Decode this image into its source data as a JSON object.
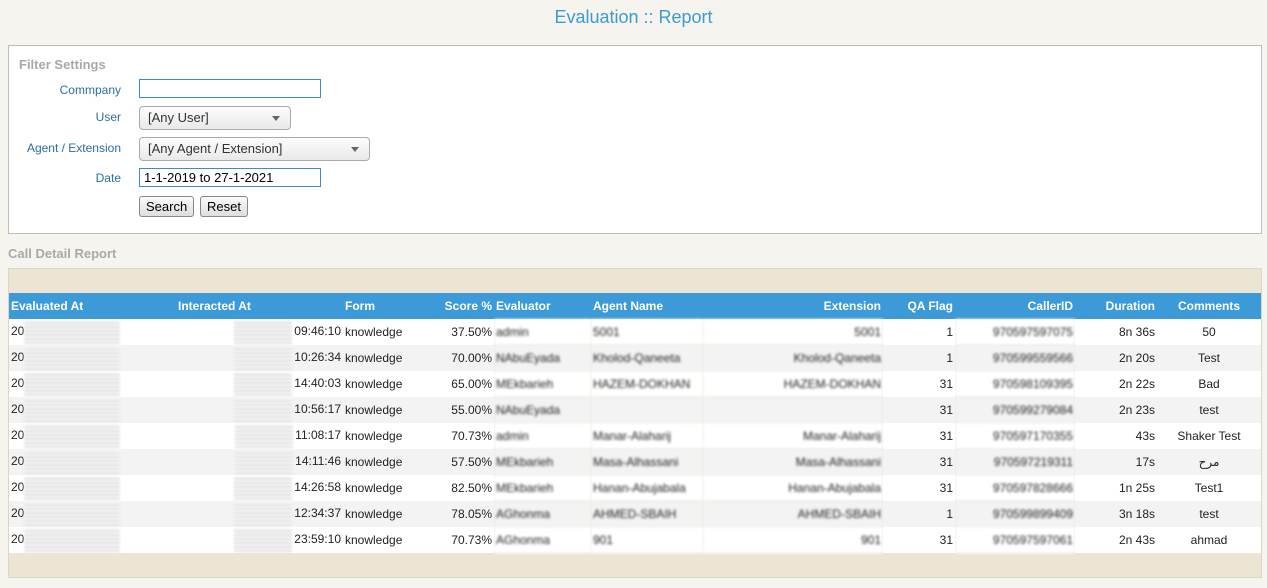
{
  "page": {
    "title": "Evaluation :: Report"
  },
  "filter": {
    "legend": "Filter Settings",
    "company_label": "Commpany",
    "company_value": "",
    "user_label": "User",
    "user_selected": "[Any User]",
    "agent_label": "Agent / Extension",
    "agent_selected": "[Any Agent / Extension]",
    "date_label": "Date",
    "date_value": "1-1-2019 to 27-1-2021",
    "search_button": "Search",
    "reset_button": "Reset"
  },
  "report": {
    "title": "Call Detail Report",
    "columns": [
      "Evaluated At",
      "Interacted At",
      "Form",
      "Score %",
      "Evaluator",
      "Agent Name",
      "Extension",
      "QA Flag",
      "CallerID",
      "Duration",
      "Comments"
    ],
    "rows": [
      {
        "evaluated_prefix": "20",
        "interacted_time": "09:46:10",
        "form": "knowledge",
        "score": "37.50%",
        "evaluator": "admin",
        "agent_name": "5001",
        "extension": "5001",
        "qa_flag": "1",
        "caller_id": "970597597075",
        "duration": "8n 36s",
        "comments": "50"
      },
      {
        "evaluated_prefix": "20",
        "interacted_time": "10:26:34",
        "form": "knowledge",
        "score": "70.00%",
        "evaluator": "NAbuEyada",
        "agent_name": "Kholod-Qaneeta",
        "extension": "Kholod-Qaneeta",
        "qa_flag": "1",
        "caller_id": "970599559566",
        "duration": "2n 20s",
        "comments": "Test"
      },
      {
        "evaluated_prefix": "20",
        "interacted_time": "14:40:03",
        "form": "knowledge",
        "score": "65.00%",
        "evaluator": "MEkbarieh",
        "agent_name": "HAZEM-DOKHAN",
        "extension": "HAZEM-DOKHAN",
        "qa_flag": "31",
        "caller_id": "970598109395",
        "duration": "2n 22s",
        "comments": "Bad"
      },
      {
        "evaluated_prefix": "20",
        "interacted_time": "10:56:17",
        "form": "knowledge",
        "score": "55.00%",
        "evaluator": "NAbuEyada",
        "agent_name": "",
        "extension": "",
        "qa_flag": "31",
        "caller_id": "970599279084",
        "duration": "2n 23s",
        "comments": "test"
      },
      {
        "evaluated_prefix": "20",
        "interacted_time": "11:08:17",
        "form": "knowledge",
        "score": "70.73%",
        "evaluator": "admin",
        "agent_name": "Manar-Alaharij",
        "extension": "Manar-Alaharij",
        "qa_flag": "31",
        "caller_id": "970597170355",
        "duration": "43s",
        "comments": "Shaker Test"
      },
      {
        "evaluated_prefix": "20",
        "interacted_time": "14:11:46",
        "form": "knowledge",
        "score": "57.50%",
        "evaluator": "MEkbarieh",
        "agent_name": "Masa-Alhassani",
        "extension": "Masa-Alhassani",
        "qa_flag": "31",
        "caller_id": "970597219311",
        "duration": "17s",
        "comments": "مرح"
      },
      {
        "evaluated_prefix": "20",
        "interacted_time": "14:26:58",
        "form": "knowledge",
        "score": "82.50%",
        "evaluator": "MEkbarieh",
        "agent_name": "Hanan-Abujabala",
        "extension": "Hanan-Abujabala",
        "qa_flag": "31",
        "caller_id": "970597828666",
        "duration": "1n 25s",
        "comments": "Test1"
      },
      {
        "evaluated_prefix": "20",
        "interacted_time": "12:34:37",
        "form": "knowledge",
        "score": "78.05%",
        "evaluator": "AGhonma",
        "agent_name": "AHMED-SBAIH",
        "extension": "AHMED-SBAIH",
        "qa_flag": "1",
        "caller_id": "970599899409",
        "duration": "3n 18s",
        "comments": "test"
      },
      {
        "evaluated_prefix": "20",
        "interacted_time": "23:59:10",
        "form": "knowledge",
        "score": "70.73%",
        "evaluator": "AGhonma",
        "agent_name": "901",
        "extension": "901",
        "qa_flag": "31",
        "caller_id": "970597597061",
        "duration": "2n 43s",
        "comments": "ahmad"
      }
    ]
  },
  "colors": {
    "accent": "#3c9ad8",
    "title": "#3c9ccf",
    "label": "#2a6fa0",
    "background": "#f6f4ee",
    "report_panel": "#ece5d3"
  }
}
